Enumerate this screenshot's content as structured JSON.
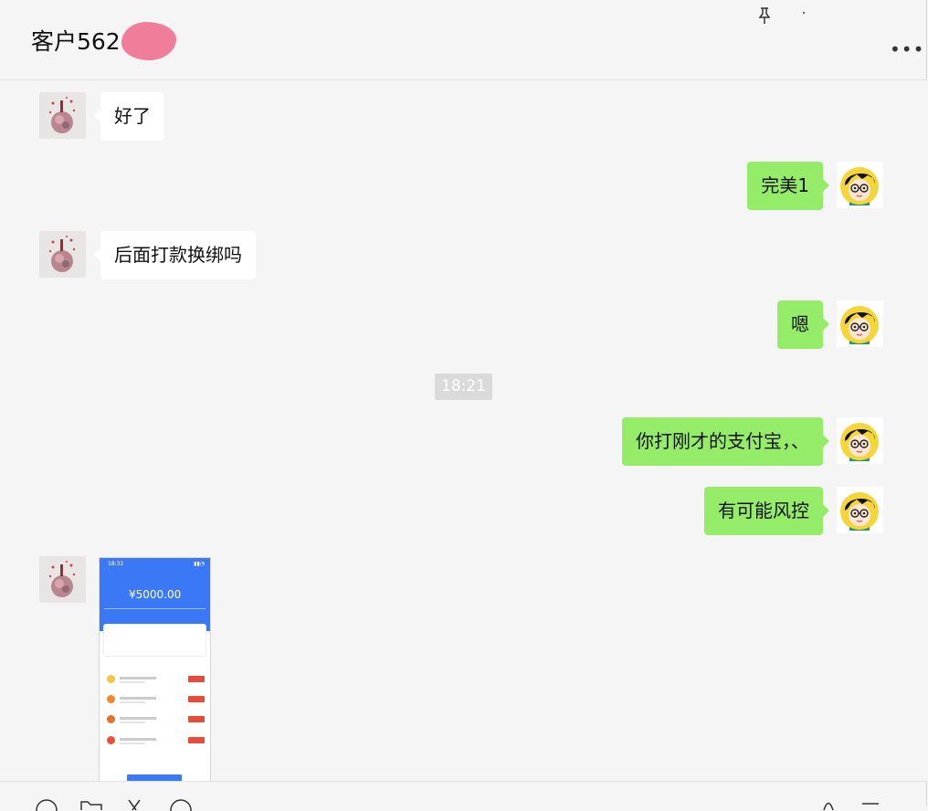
{
  "header": {
    "title": "客户562"
  },
  "messages": [
    {
      "side": "in",
      "text": "好了"
    },
    {
      "side": "out",
      "text": "完美1"
    },
    {
      "side": "in",
      "text": "后面打款换绑吗"
    },
    {
      "side": "out",
      "text": "嗯"
    },
    {
      "side": "out",
      "text": "你打刚才的支付宝，、"
    },
    {
      "side": "out",
      "text": "有可能风控"
    }
  ],
  "timestamp": "18:21",
  "image_message": {
    "status_time": "18:32",
    "amount": "¥5000.00"
  },
  "colors": {
    "outgoing_bubble": "#95ec69",
    "incoming_bubble": "#ffffff",
    "background": "#f5f5f5"
  }
}
